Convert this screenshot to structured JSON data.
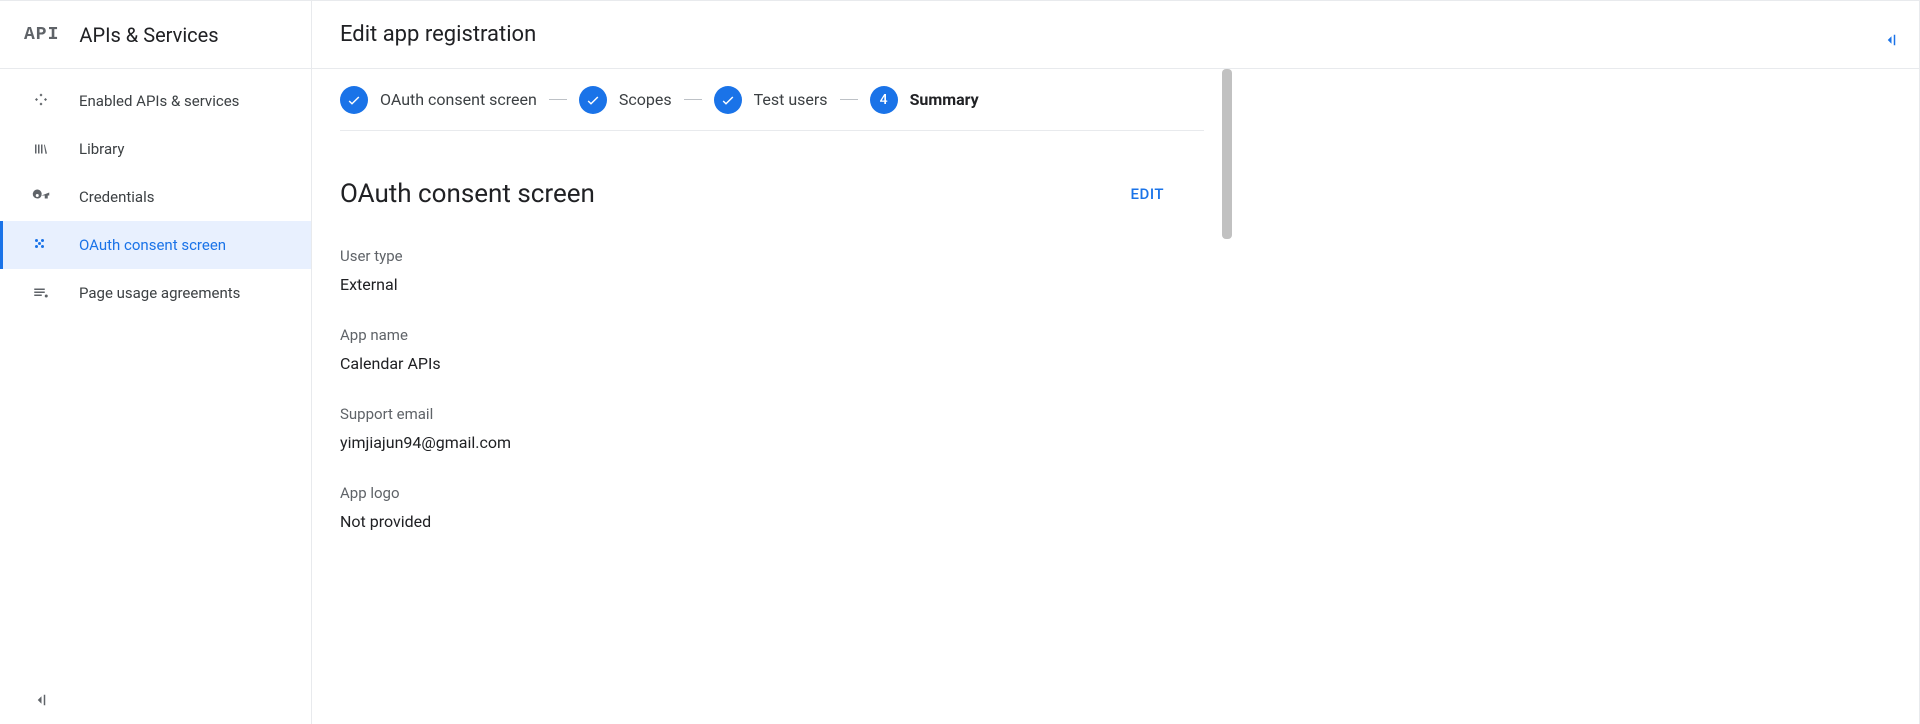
{
  "sidebar": {
    "badge": "API",
    "title": "APIs & Services",
    "items": [
      {
        "label": "Enabled APIs & services",
        "icon": "api"
      },
      {
        "label": "Library",
        "icon": "library"
      },
      {
        "label": "Credentials",
        "icon": "key"
      },
      {
        "label": "OAuth consent screen",
        "icon": "consent"
      },
      {
        "label": "Page usage agreements",
        "icon": "agreements"
      }
    ]
  },
  "page": {
    "title": "Edit app registration"
  },
  "stepper": {
    "steps": [
      {
        "label": "OAuth consent screen",
        "done": true
      },
      {
        "label": "Scopes",
        "done": true
      },
      {
        "label": "Test users",
        "done": true
      },
      {
        "label": "Summary",
        "done": false,
        "number": "4",
        "current": true
      }
    ]
  },
  "section": {
    "title": "OAuth consent screen",
    "edit": "EDIT"
  },
  "fields": {
    "user_type": {
      "label": "User type",
      "value": "External"
    },
    "app_name": {
      "label": "App name",
      "value": "Calendar APIs"
    },
    "support_email": {
      "label": "Support email",
      "value": "yimjiajun94@gmail.com"
    },
    "app_logo": {
      "label": "App logo",
      "value": "Not provided"
    }
  }
}
